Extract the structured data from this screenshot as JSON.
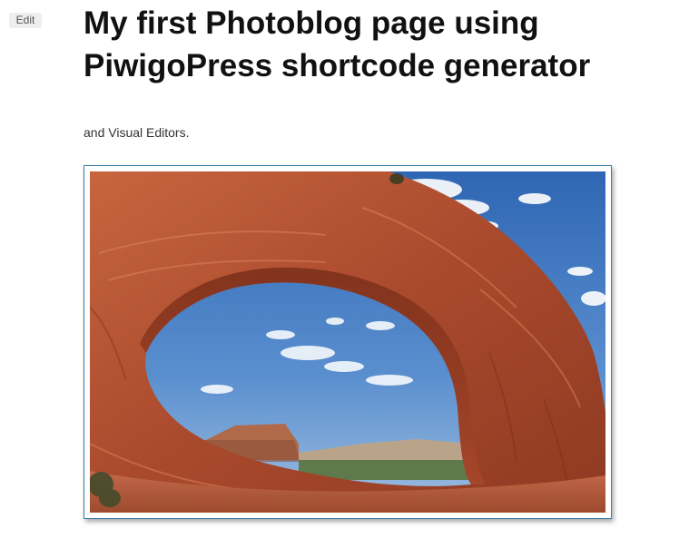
{
  "post": {
    "edit_label": "Edit",
    "title": "My first Photoblog page using PiwigoPress shortcode generator",
    "intro": "and Visual Editors."
  },
  "photo": {
    "subject": "sandstone-arch-photo",
    "colors": {
      "sky": "#4a7fc1",
      "rock": "#b8583a",
      "frame_border": "#3a7fa8"
    }
  }
}
